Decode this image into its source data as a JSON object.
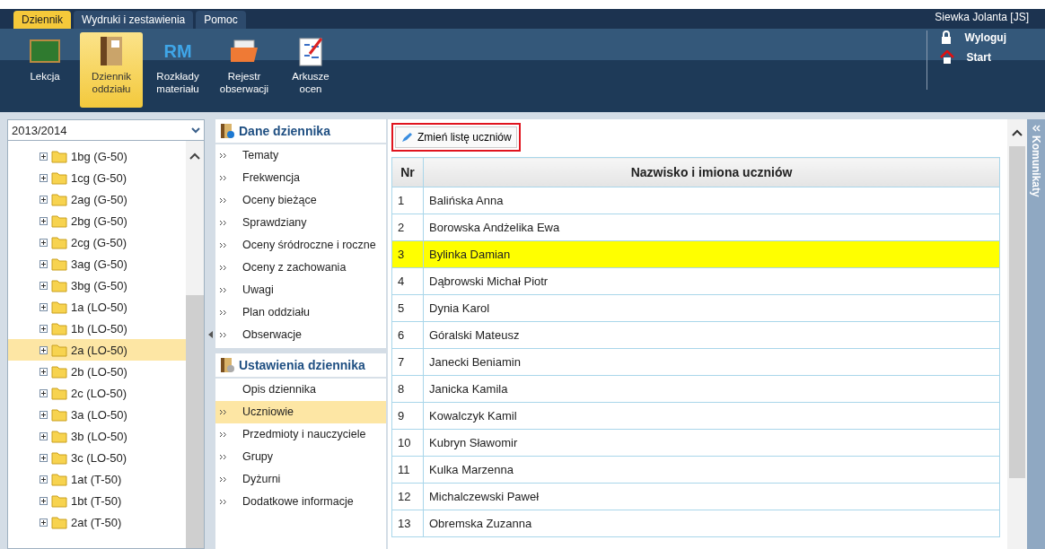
{
  "tabs": [
    {
      "label": "Dziennik",
      "selected": true
    },
    {
      "label": "Wydruki i zestawienia",
      "selected": false
    },
    {
      "label": "Pomoc",
      "selected": false
    }
  ],
  "user": "Siewka Jolanta [JS]",
  "toolbar": [
    {
      "kind": "board",
      "label": "Lekcja",
      "selected": false
    },
    {
      "kind": "book",
      "label": "Dziennik oddziału",
      "selected": true
    },
    {
      "kind": "letters",
      "icon_text": "RM",
      "label": "Rozkłady materiału",
      "selected": false
    },
    {
      "kind": "folder",
      "label": "Rejestr obserwacji",
      "selected": false
    },
    {
      "kind": "sheet",
      "label": "Arkusze ocen",
      "selected": false
    }
  ],
  "account_links": [
    {
      "kind": "lock",
      "label": "Wyloguj"
    },
    {
      "kind": "home",
      "label": "Start"
    }
  ],
  "year_select": {
    "value": "2013/2014"
  },
  "tree": [
    {
      "label": "1bg (G-50)",
      "expanded": false,
      "selected": false
    },
    {
      "label": "1cg (G-50)",
      "expanded": false,
      "selected": false
    },
    {
      "label": "2ag (G-50)",
      "expanded": false,
      "selected": false
    },
    {
      "label": "2bg (G-50)",
      "expanded": false,
      "selected": false
    },
    {
      "label": "2cg (G-50)",
      "expanded": false,
      "selected": false
    },
    {
      "label": "3ag (G-50)",
      "expanded": false,
      "selected": false
    },
    {
      "label": "3bg (G-50)",
      "expanded": false,
      "selected": false
    },
    {
      "label": "1a (LO-50)",
      "expanded": false,
      "selected": false
    },
    {
      "label": "1b (LO-50)",
      "expanded": false,
      "selected": false
    },
    {
      "label": "2a (LO-50)",
      "expanded": false,
      "selected": true
    },
    {
      "label": "2b (LO-50)",
      "expanded": false,
      "selected": false
    },
    {
      "label": "2c (LO-50)",
      "expanded": false,
      "selected": false
    },
    {
      "label": "3a (LO-50)",
      "expanded": false,
      "selected": false
    },
    {
      "label": "3b (LO-50)",
      "expanded": false,
      "selected": false
    },
    {
      "label": "3c (LO-50)",
      "expanded": false,
      "selected": false
    },
    {
      "label": "1at (T-50)",
      "expanded": false,
      "selected": false
    },
    {
      "label": "1bt (T-50)",
      "expanded": false,
      "selected": false
    },
    {
      "label": "2at (T-50)",
      "expanded": false,
      "selected": false
    }
  ],
  "nav_sections": [
    {
      "title": "Dane dziennika",
      "kind": "info",
      "items": [
        {
          "label": "Tematy",
          "arrow": true,
          "selected": false
        },
        {
          "label": "Frekwencja",
          "arrow": true,
          "selected": false
        },
        {
          "label": "Oceny bieżące",
          "arrow": true,
          "selected": false
        },
        {
          "label": "Sprawdziany",
          "arrow": true,
          "selected": false
        },
        {
          "label": "Oceny śródroczne i roczne",
          "arrow": true,
          "selected": false
        },
        {
          "label": "Oceny z zachowania",
          "arrow": true,
          "selected": false
        },
        {
          "label": "Uwagi",
          "arrow": true,
          "selected": false
        },
        {
          "label": "Plan oddziału",
          "arrow": true,
          "selected": false
        },
        {
          "label": "Obserwacje",
          "arrow": true,
          "selected": false
        }
      ]
    },
    {
      "title": "Ustawienia dziennika",
      "kind": "settings",
      "items": [
        {
          "label": "Opis dziennika",
          "arrow": false,
          "selected": false
        },
        {
          "label": "Uczniowie",
          "arrow": true,
          "selected": true
        },
        {
          "label": "Przedmioty i nauczyciele",
          "arrow": true,
          "selected": false
        },
        {
          "label": "Grupy",
          "arrow": true,
          "selected": false
        },
        {
          "label": "Dyżurni",
          "arrow": true,
          "selected": false
        },
        {
          "label": "Dodatkowe informacje",
          "arrow": true,
          "selected": false
        }
      ]
    }
  ],
  "edit_button": {
    "label": "Zmień listę uczniów",
    "highlighted": true
  },
  "table": {
    "columns": [
      "Nr",
      "Nazwisko i imiona uczniów"
    ],
    "rows": [
      {
        "cells": [
          "1",
          "Balińska Anna"
        ],
        "selected": false
      },
      {
        "cells": [
          "2",
          "Borowska Andżelika Ewa"
        ],
        "selected": false
      },
      {
        "cells": [
          "3",
          "Bylinka Damian"
        ],
        "selected": true
      },
      {
        "cells": [
          "4",
          "Dąbrowski Michał Piotr"
        ],
        "selected": false
      },
      {
        "cells": [
          "5",
          "Dynia Karol"
        ],
        "selected": false
      },
      {
        "cells": [
          "6",
          "Góralski Mateusz"
        ],
        "selected": false
      },
      {
        "cells": [
          "7",
          "Janecki Beniamin"
        ],
        "selected": false
      },
      {
        "cells": [
          "8",
          "Janicka Kamila"
        ],
        "selected": false
      },
      {
        "cells": [
          "9",
          "Kowalczyk Kamil"
        ],
        "selected": false
      },
      {
        "cells": [
          "10",
          "Kubryn Sławomir"
        ],
        "selected": false
      },
      {
        "cells": [
          "11",
          "Kulka Marzenna"
        ],
        "selected": false
      },
      {
        "cells": [
          "12",
          "Michalczewski Paweł"
        ],
        "selected": false
      },
      {
        "cells": [
          "13",
          "Obremska Zuzanna"
        ],
        "selected": false
      }
    ]
  },
  "side_panel": {
    "label": "Komunikaty"
  }
}
